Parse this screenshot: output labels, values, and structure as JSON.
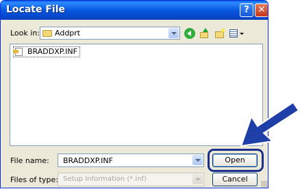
{
  "window": {
    "title": "Locate File"
  },
  "lookin": {
    "label": "Look in:",
    "value": "Addprt"
  },
  "toolbar": {
    "icons": [
      "back-icon",
      "up-folder-icon",
      "new-folder-icon",
      "views-menu-icon"
    ]
  },
  "files": [
    {
      "name": "BRADDXP.INF"
    }
  ],
  "filename": {
    "label": "File name:",
    "value": "BRADDXP.INF"
  },
  "filetype": {
    "label": "Files of type:",
    "value": "Setup Information (*.inf)"
  },
  "buttons": {
    "open": "Open",
    "cancel": "Cancel"
  },
  "colors": {
    "titlebar": "#0757e0",
    "highlight": "#1a2f8c",
    "arrow": "#1f3fa8"
  }
}
